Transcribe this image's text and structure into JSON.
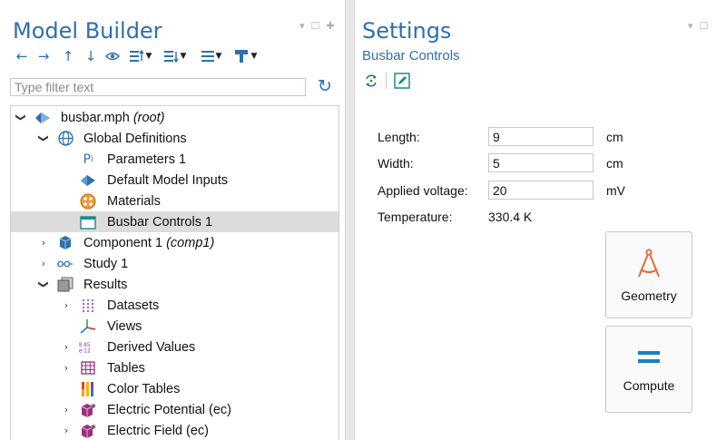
{
  "model_builder": {
    "title": "Model Builder",
    "filter_placeholder": "Type filter text",
    "toolbar_icons": [
      "back-arrow-icon",
      "forward-arrow-icon",
      "up-arrow-icon",
      "down-arrow-icon",
      "show-icon",
      "expand-sections-icon",
      "model-tree-node-icon",
      "collapse-icon",
      "build-icon"
    ],
    "tree": [
      {
        "label": "busbar.mph",
        "suffix": "(root)",
        "icon": "root-model-icon",
        "level": 0,
        "arrow": "expanded"
      },
      {
        "label": "Global Definitions",
        "suffix": "",
        "icon": "globe-icon",
        "level": 1,
        "arrow": "expanded"
      },
      {
        "label": "Parameters 1",
        "suffix": "",
        "icon": "parameters-icon",
        "level": 2,
        "arrow": ""
      },
      {
        "label": "Default Model Inputs",
        "suffix": "",
        "icon": "model-inputs-icon",
        "level": 2,
        "arrow": ""
      },
      {
        "label": "Materials",
        "suffix": "",
        "icon": "materials-icon",
        "level": 2,
        "arrow": ""
      },
      {
        "label": "Busbar Controls 1",
        "suffix": "",
        "icon": "form-icon",
        "level": 2,
        "arrow": "",
        "selected": true
      },
      {
        "label": "Component 1",
        "suffix": "(comp1)",
        "icon": "component-cube-icon",
        "level": 1,
        "arrow": "collapsed"
      },
      {
        "label": "Study 1",
        "suffix": "",
        "icon": "study-icon",
        "level": 1,
        "arrow": "collapsed"
      },
      {
        "label": "Results",
        "suffix": "",
        "icon": "results-icon",
        "level": 1,
        "arrow": "expanded"
      },
      {
        "label": "Datasets",
        "suffix": "",
        "icon": "datasets-icon",
        "level": 2,
        "arrow": "collapsed"
      },
      {
        "label": "Views",
        "suffix": "",
        "icon": "views-axes-icon",
        "level": 2,
        "arrow": ""
      },
      {
        "label": "Derived Values",
        "suffix": "",
        "icon": "derived-values-icon",
        "level": 2,
        "arrow": "collapsed"
      },
      {
        "label": "Tables",
        "suffix": "",
        "icon": "tables-icon",
        "level": 2,
        "arrow": "collapsed"
      },
      {
        "label": "Color Tables",
        "suffix": "",
        "icon": "color-tables-icon",
        "level": 2,
        "arrow": ""
      },
      {
        "label": "Electric Potential (ec)",
        "suffix": "",
        "icon": "plot-group-icon",
        "level": 2,
        "arrow": "collapsed"
      },
      {
        "label": "Electric Field (ec)",
        "suffix": "",
        "icon": "plot-group-icon",
        "level": 2,
        "arrow": "collapsed"
      }
    ]
  },
  "settings": {
    "title": "Settings",
    "subtitle": "Busbar Controls",
    "toolbar_icons": [
      "rebuild-icon",
      "edit-form-icon"
    ],
    "fields": {
      "length": {
        "label": "Length:",
        "value": "9",
        "unit": "cm"
      },
      "width": {
        "label": "Width:",
        "value": "5",
        "unit": "cm"
      },
      "voltage": {
        "label": "Applied voltage:",
        "value": "20",
        "unit": "mV"
      },
      "temperature": {
        "label": "Temperature:",
        "value": "330.4 K"
      }
    },
    "buttons": {
      "geometry": {
        "label": "Geometry",
        "icon": "compass-icon"
      },
      "compute": {
        "label": "Compute",
        "icon": "equals-icon"
      }
    }
  },
  "colors": {
    "accent": "#2e6fae",
    "selection": "#dcdcdc",
    "geometry_icon": "#e46a3c",
    "compute_icon": "#1a7fc4"
  }
}
